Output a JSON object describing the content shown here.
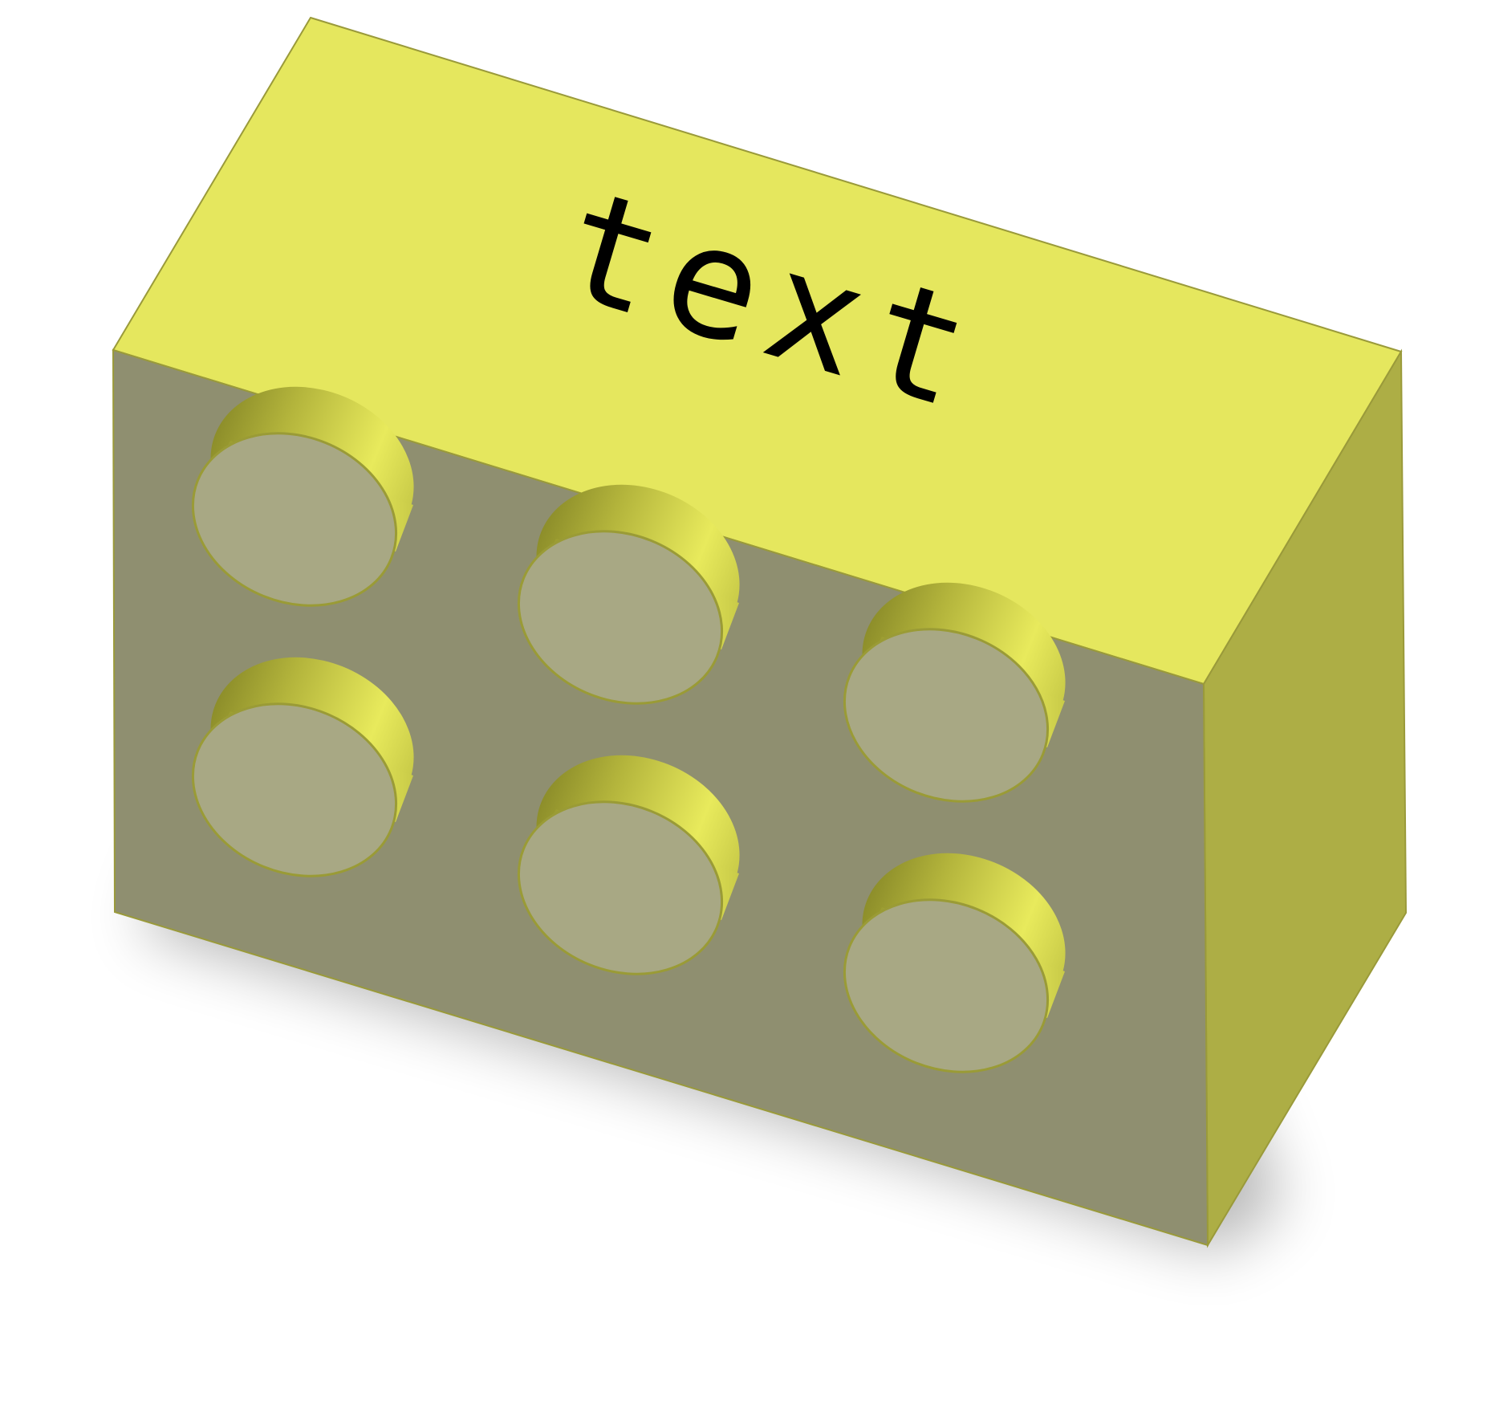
{
  "brick": {
    "label": "text",
    "colors": {
      "top_face": "#e5e75e",
      "front_face": "#8f8f70",
      "side_face": "#adae45",
      "stud_top": "#a8a884",
      "stud_wall_light": "#e8ea5c",
      "stud_wall_dark": "#8d8e2a",
      "edge": "#9a9a3a",
      "label_color": "#000000"
    },
    "stud_rows": 2,
    "stud_columns": 3,
    "studs": [
      {
        "name": "stud-row1-col1"
      },
      {
        "name": "stud-row1-col2"
      },
      {
        "name": "stud-row1-col3"
      },
      {
        "name": "stud-row2-col1"
      },
      {
        "name": "stud-row2-col2"
      },
      {
        "name": "stud-row2-col3"
      }
    ]
  }
}
